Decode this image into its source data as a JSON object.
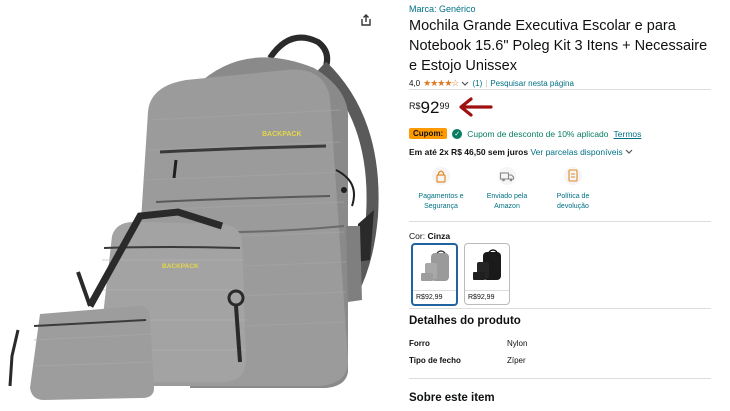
{
  "product": {
    "brand": "Marca: Genérico",
    "title": "Mochila Grande Executiva Escolar e para Notebook 15.6\" Poleg Kit 3 Itens + Necessaire e Estojo Unissex",
    "rating": "4,0",
    "stars": "★★★★☆",
    "review_count": "(1)",
    "search_link": "Pesquisar nesta página"
  },
  "price": {
    "currency": "R$",
    "whole": "92",
    "fraction": "99"
  },
  "coupon": {
    "badge": "Cupom:",
    "text": "Cupom de desconto de 10% aplicado",
    "terms": "Termos"
  },
  "installments": {
    "bold_text": "Em até 2x R$ 46,50 sem juros",
    "link": "Ver parcelas disponíveis"
  },
  "features": [
    {
      "label": "Pagamentos e Segurança",
      "icon": "lock-icon"
    },
    {
      "label": "Enviado pela Amazon",
      "icon": "truck-icon"
    },
    {
      "label": "Política de devolução",
      "icon": "return-icon"
    }
  ],
  "color": {
    "label": "Cor:",
    "selected": "Cinza",
    "options": [
      {
        "name": "grey",
        "price": "R$92,99",
        "swatch": "#9a9a9a"
      },
      {
        "name": "black",
        "price": "R$92,99",
        "swatch": "#1a1a1a"
      }
    ]
  },
  "details": {
    "heading": "Detalhes do produto",
    "rows": [
      {
        "key": "Forro",
        "value": "Nylon"
      },
      {
        "key": "Tipo de fecho",
        "value": "Zíper"
      }
    ]
  },
  "about_heading": "Sobre este item",
  "colors": {
    "link": "#007185",
    "star": "#de7921",
    "coupon_badge": "#ff9900",
    "coupon_green": "#067d62",
    "arrow": "#a01010",
    "swatch_selected": "#2162a1"
  }
}
